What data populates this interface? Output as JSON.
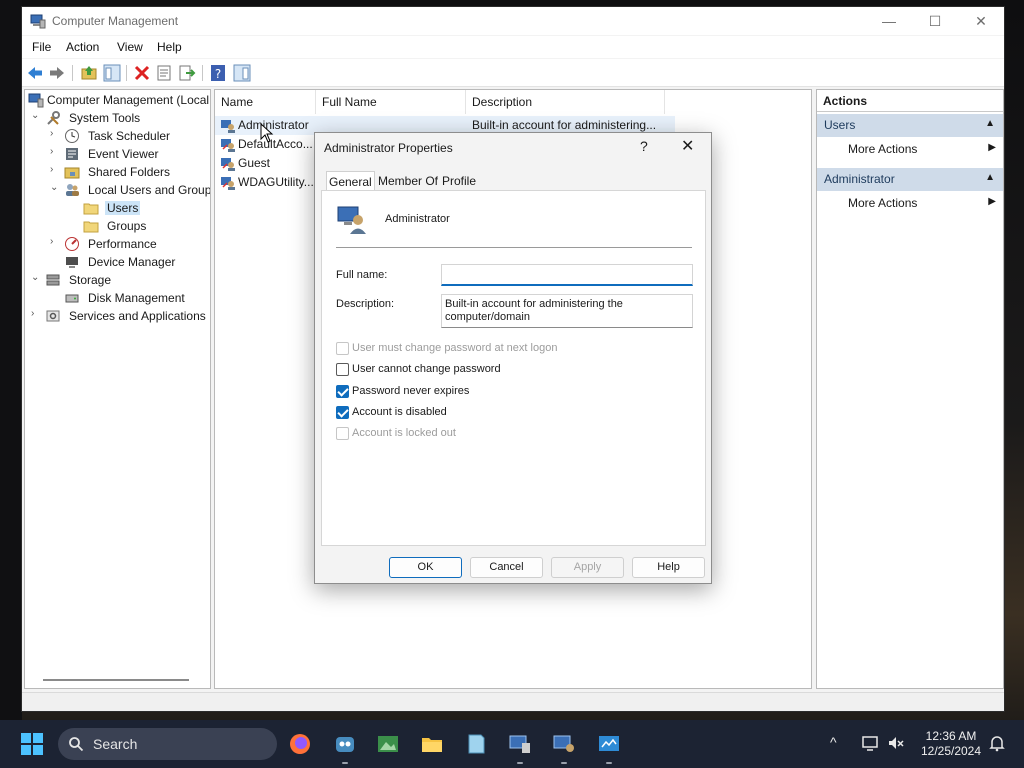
{
  "window": {
    "title": "Computer Management",
    "minimize_glyph": "—",
    "maximize_glyph": "☐",
    "close_glyph": "✕"
  },
  "menu": [
    "File",
    "Action",
    "View",
    "Help"
  ],
  "toolbar_icons": [
    "back-arrow-icon",
    "forward-arrow-icon",
    "up-folder-icon",
    "show-hide-tree-icon",
    "delete-icon",
    "properties-icon",
    "export-list-icon",
    "help-icon",
    "show-hide-action-pane-icon"
  ],
  "tree": {
    "root": "Computer Management (Local",
    "system_tools": "System Tools",
    "task_scheduler": "Task Scheduler",
    "event_viewer": "Event Viewer",
    "shared_folders": "Shared Folders",
    "local_users_groups": "Local Users and Groups",
    "users": "Users",
    "groups": "Groups",
    "performance": "Performance",
    "device_manager": "Device Manager",
    "storage": "Storage",
    "disk_management": "Disk Management",
    "services_apps": "Services and Applications"
  },
  "list": {
    "columns": [
      "Name",
      "Full Name",
      "Description"
    ],
    "rows": [
      {
        "name": "Administrator",
        "full_name": "",
        "description": "Built-in account for administering..."
      },
      {
        "name": "DefaultAcco...",
        "full_name": "",
        "description": ""
      },
      {
        "name": "Guest",
        "full_name": "",
        "description": ""
      },
      {
        "name": "WDAGUtility...",
        "full_name": "",
        "description": ""
      }
    ]
  },
  "actions": {
    "header": "Actions",
    "section1": "Users",
    "section1_item": "More Actions",
    "section2": "Administrator",
    "section2_item": "More Actions"
  },
  "dialog": {
    "title": "Administrator Properties",
    "help_glyph": "?",
    "close_glyph": "✕",
    "tabs": [
      "General",
      "Member Of",
      "Profile"
    ],
    "username": "Administrator",
    "full_name_label": "Full name:",
    "full_name_value": "",
    "description_label": "Description:",
    "description_value": "Built-in account for administering the computer/domain",
    "checkboxes": [
      {
        "label": "User must change password at next logon",
        "checked": false,
        "disabled": true
      },
      {
        "label": "User cannot change password",
        "checked": false,
        "disabled": false
      },
      {
        "label": "Password never expires",
        "checked": true,
        "disabled": false
      },
      {
        "label": "Account is disabled",
        "checked": true,
        "disabled": false
      },
      {
        "label": "Account is locked out",
        "checked": false,
        "disabled": true
      }
    ],
    "buttons": {
      "ok": "OK",
      "cancel": "Cancel",
      "apply": "Apply",
      "help": "Help"
    }
  },
  "taskbar": {
    "search_label": "Search",
    "apps": [
      "firefox-icon",
      "godot-icon",
      "image-viewer-icon",
      "file-explorer-icon",
      "notepad-icon",
      "computer-management-icon",
      "remote-desktop-icon",
      "control-panel-icon"
    ],
    "time": "12:36 AM",
    "date": "12/25/2024"
  },
  "colors": {
    "accent": "#0f6cbd",
    "selection": "#cce4f7",
    "actions_section": "#cfdbe9",
    "taskbar": "#1c2333"
  }
}
